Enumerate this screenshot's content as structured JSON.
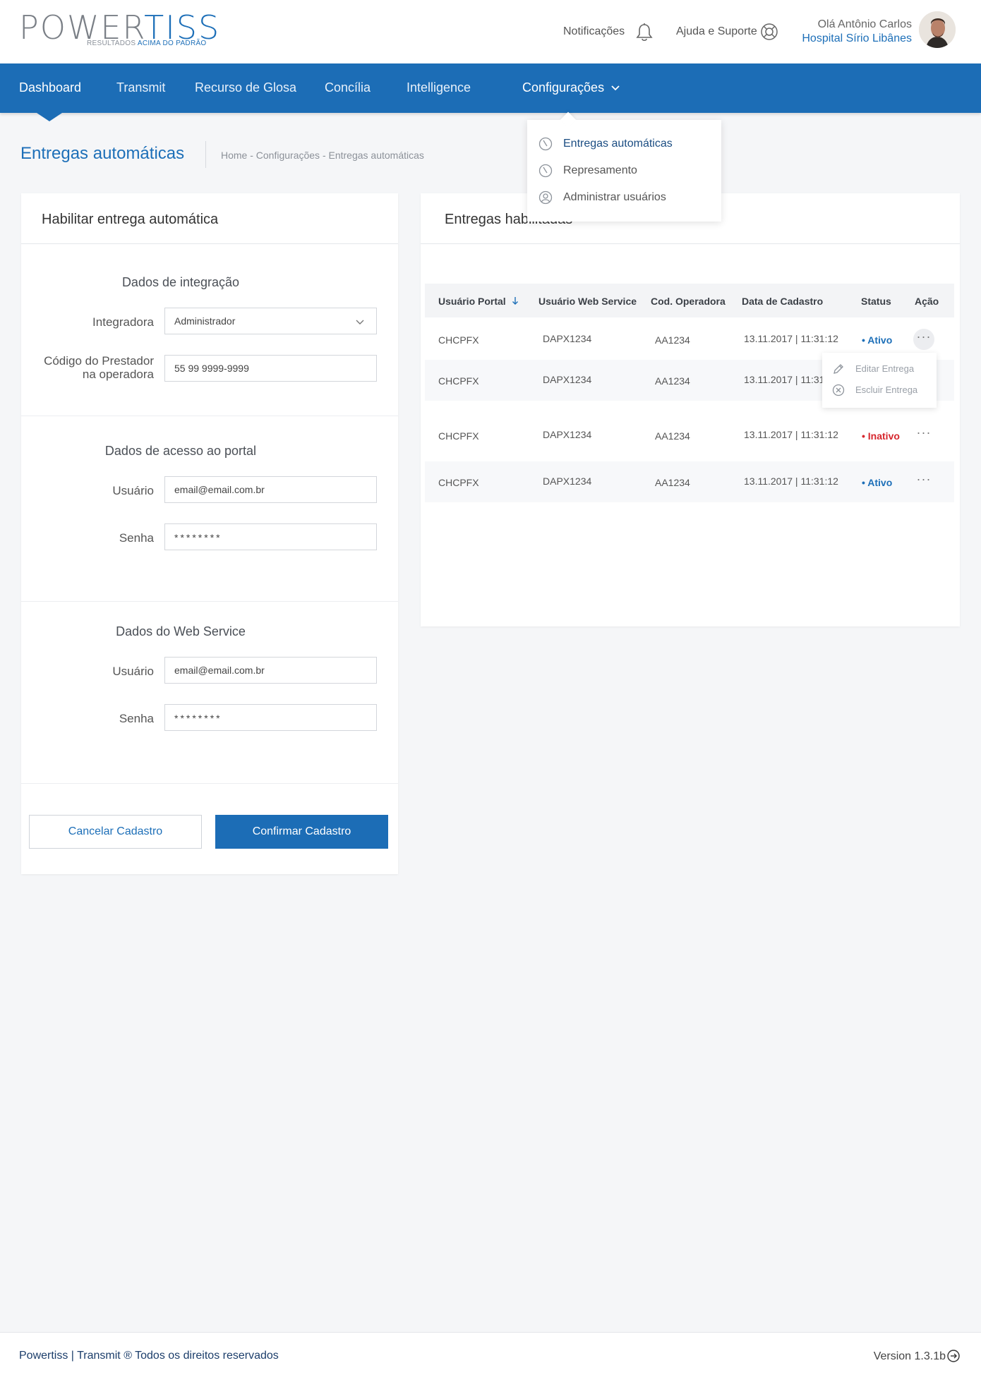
{
  "header": {
    "logo_main": "POWER",
    "logo_accent": "TISS",
    "logo_tagline": "RESULTADOS",
    "logo_tagline_strong": "ACIMA DO PADRÃO",
    "notifications": "Notificações",
    "help": "Ajuda e Suporte",
    "greeting": "Olá Antônio Carlos",
    "hospital": "Hospital Sírio Libânes"
  },
  "nav": {
    "items": [
      "Dashboard",
      "Transmit",
      "Recurso de Glosa",
      "Concília",
      "Intelligence",
      "Configurações"
    ]
  },
  "dropdown": {
    "items": [
      "Entregas automáticas",
      "Represamento",
      "Administrar usuários"
    ]
  },
  "page": {
    "title": "Entregas automáticas",
    "breadcrumb": "Home - Configurações - Entregas automáticas"
  },
  "form": {
    "panel_title": "Habilitar entrega automática",
    "integration": {
      "title": "Dados de integração",
      "integradora_label": "Integradora",
      "integradora_value": "Administrador",
      "codigo_label_1": "Código do Prestador",
      "codigo_label_2": "na operadora",
      "codigo_value": "55 99 9999-9999"
    },
    "portal": {
      "title": "Dados de acesso ao portal",
      "usuario_label": "Usuário",
      "usuario_value": "email@email.com.br",
      "senha_label": "Senha",
      "senha_value": "********"
    },
    "webservice": {
      "title": "Dados do Web Service",
      "usuario_label": "Usuário",
      "usuario_value": "email@email.com.br",
      "senha_label": "Senha",
      "senha_value": "********"
    },
    "cancel": "Cancelar Cadastro",
    "confirm": "Confirmar Cadastro"
  },
  "table": {
    "panel_title": "Entregas habilitadas",
    "headers": [
      "Usuário Portal",
      "Usuário Web Service",
      "Cod. Operadora",
      "Data de Cadastro",
      "Status",
      "Ação"
    ],
    "rows": [
      {
        "portal": "CHCPFX",
        "ws": "DAPX1234",
        "cod": "AA1234",
        "date": "13.11.2017 | 11:31:12",
        "status": "• Ativo",
        "action": "···"
      },
      {
        "portal": "CHCPFX",
        "ws": "DAPX1234",
        "cod": "AA1234",
        "date": "13.11.2017 | 11:31:12",
        "status": "",
        "action": ""
      },
      {
        "portal": "CHCPFX",
        "ws": "DAPX1234",
        "cod": "AA1234",
        "date": "13.11.2017 | 11:31:12",
        "status": "• Inativo",
        "action": "···"
      },
      {
        "portal": "CHCPFX",
        "ws": "DAPX1234",
        "cod": "AA1234",
        "date": "13.11.2017 | 11:31:12",
        "status": "• Ativo",
        "action": "···"
      }
    ],
    "context_menu": [
      "Editar Entrega",
      "Escluir Entrega"
    ]
  },
  "footer": {
    "left": "Powertiss | Transmit ® Todos os direitos reservados",
    "version": "Version 1.3.1b"
  },
  "colors": {
    "primary": "#1c6db6",
    "active": "#1d6fb8",
    "inactive": "#d6262d"
  }
}
